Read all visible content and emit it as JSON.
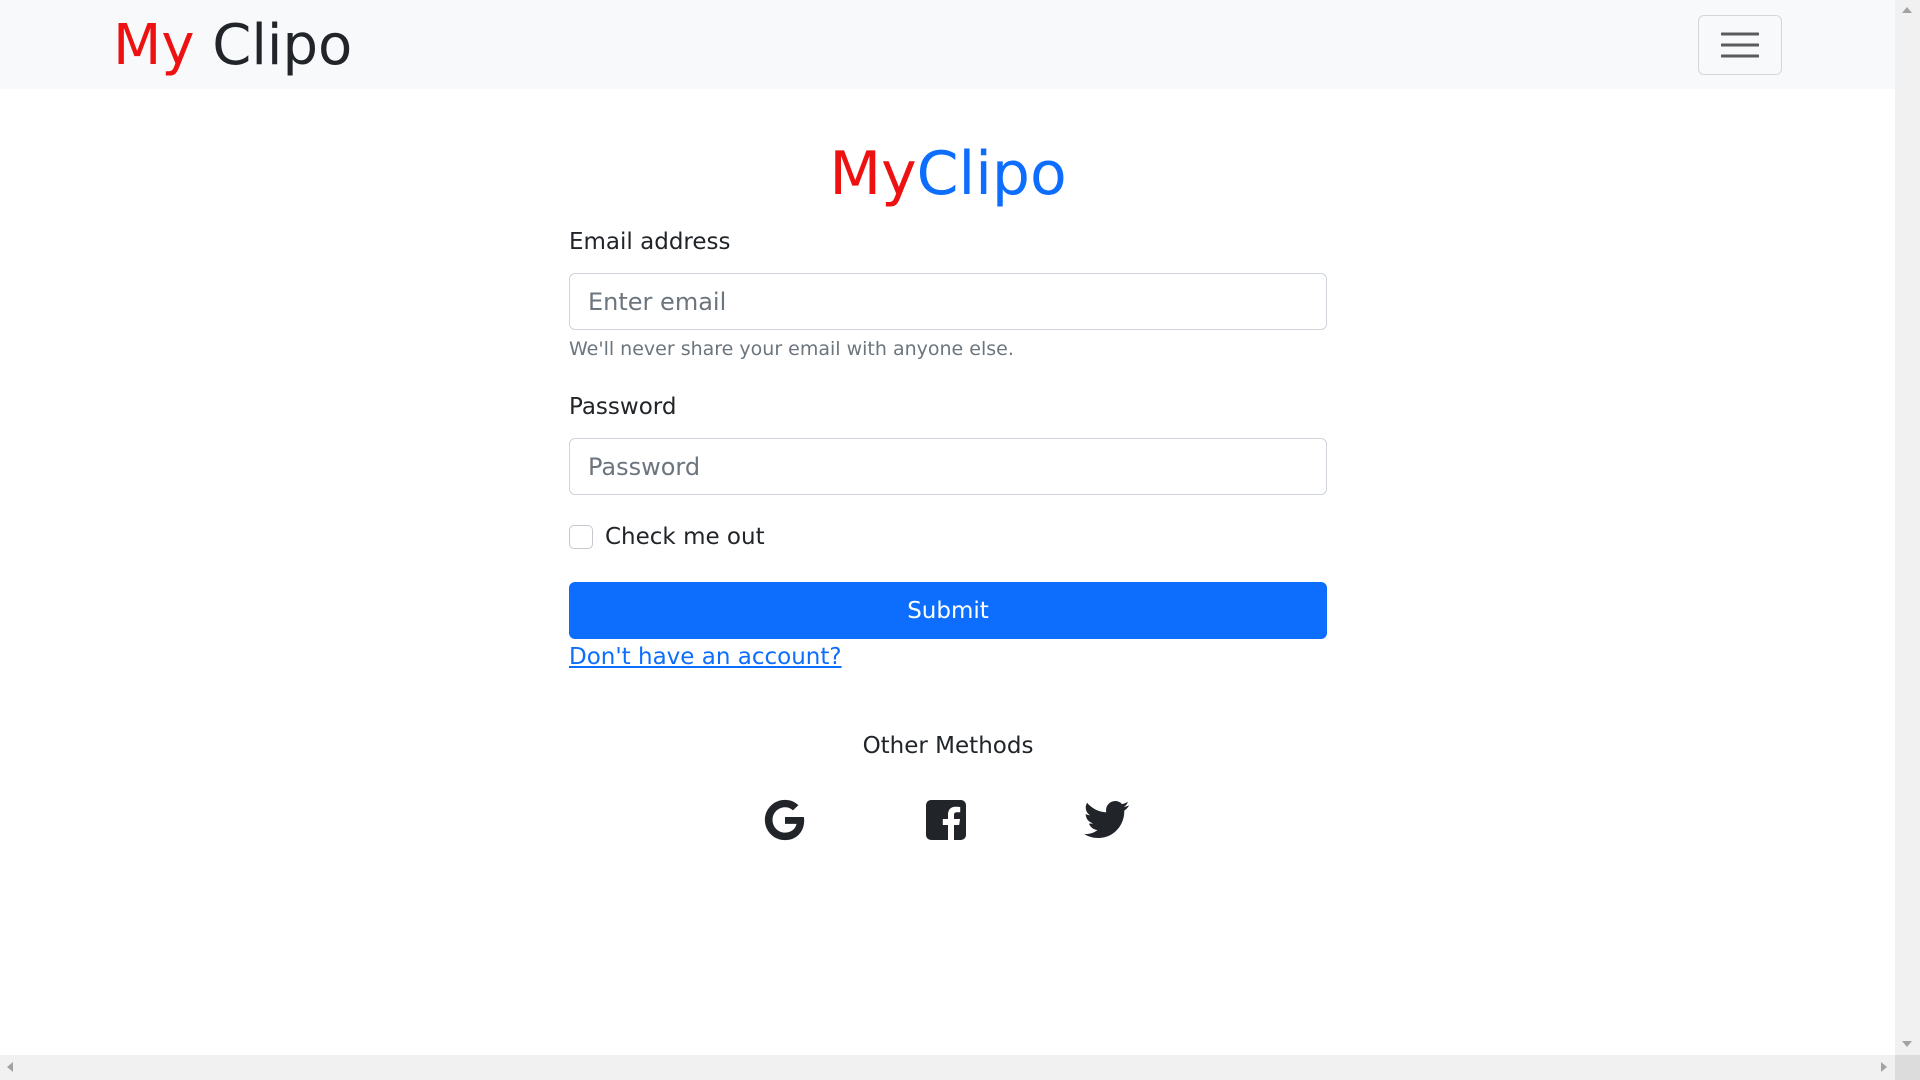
{
  "navbar": {
    "brand_my": "My",
    "brand_clipo": " Clipo",
    "toggler_icon": "hamburger-menu-icon"
  },
  "login": {
    "title_my": "My",
    "title_clipo": "Clipo",
    "email_label": "Email address",
    "email_placeholder": "Enter email",
    "email_value": "",
    "email_help": "We'll never share your email with anyone else.",
    "password_label": "Password",
    "password_placeholder": "Password",
    "password_value": "",
    "checkbox_label": "Check me out",
    "checkbox_checked": false,
    "submit_label": "Submit",
    "signup_link": "Don't have an account?"
  },
  "other_methods": {
    "heading": "Other Methods",
    "providers": [
      {
        "name": "Google",
        "icon": "google-icon"
      },
      {
        "name": "Facebook",
        "icon": "facebook-icon"
      },
      {
        "name": "Twitter",
        "icon": "twitter-icon"
      }
    ]
  },
  "colors": {
    "brand_red": "#ee1111",
    "primary_blue": "#0d6efd",
    "navbar_bg": "#f8f9fa",
    "text_dark": "#212529",
    "text_muted": "#6c757d",
    "input_border": "#ced4da"
  }
}
